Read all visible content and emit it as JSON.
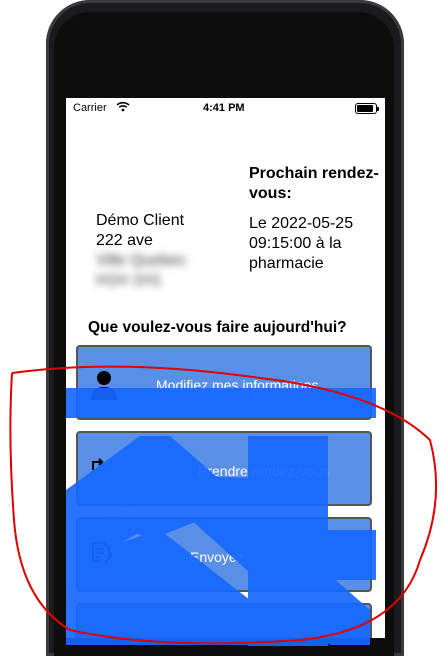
{
  "status_bar": {
    "carrier": "Carrier",
    "time": "4:41 PM"
  },
  "client": {
    "name": "Démo Client",
    "address_line1": "222 ave",
    "address_line2": "Ville Quebec",
    "address_line3": "H1H 1H1"
  },
  "appointment": {
    "title": "Prochain rendez-vous:",
    "details": "Le 2022-05-25 09:15:00 à la pharmacie"
  },
  "question": "Que voulez-vous faire aujourd'hui?",
  "actions": [
    {
      "label": "Modifiez mes informations",
      "icon": "person-icon"
    },
    {
      "label": "Prendre rendez-vous",
      "icon": "reschedule-icon"
    },
    {
      "label": "Envoyez",
      "icon": "prescription-icon"
    }
  ],
  "colors": {
    "button_bg": "#5a8fe8",
    "overlay_blue": "#1668ff",
    "annotation_red": "#e00000"
  }
}
